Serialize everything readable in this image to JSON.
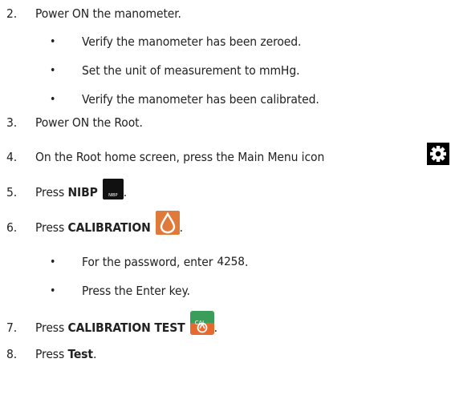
{
  "steps": [
    {
      "num": "2.",
      "text": "Power ON the manometer."
    },
    {
      "num": "3.",
      "text": "Power ON the Root."
    },
    {
      "num": "4.",
      "text": "On the Root home screen, press the Main Menu icon"
    },
    {
      "num": "5.",
      "prefix": "Press",
      "bold": "NIBP",
      "suffix": "."
    },
    {
      "num": "6.",
      "prefix": "Press",
      "bold": "CALIBRATION",
      "suffix": "."
    },
    {
      "num": "7.",
      "prefix": "Press",
      "bold": "CALIBRATION TEST",
      "suffix": "."
    },
    {
      "num": "8.",
      "prefix": "Press",
      "bold": "Test",
      "suffix": "."
    }
  ],
  "step2_bullets": [
    "Verify the manometer has been zeroed.",
    "Set the unit of measurement to mmHg.",
    "Verify the manometer has been calibrated."
  ],
  "step6_bullets": [
    {
      "text": "For the password, enter",
      "code": "4258",
      "suffix": "."
    },
    {
      "text": "Press the Enter key."
    }
  ],
  "bullet_char": "•",
  "icons": {
    "main_menu": "gear-icon",
    "nibp": "nibp-button-icon",
    "nibp_label": "NIBP",
    "calibration": "calibration-drop-icon",
    "calibration_test": "calibration-test-icon",
    "calibration_test_label": "CAL"
  }
}
